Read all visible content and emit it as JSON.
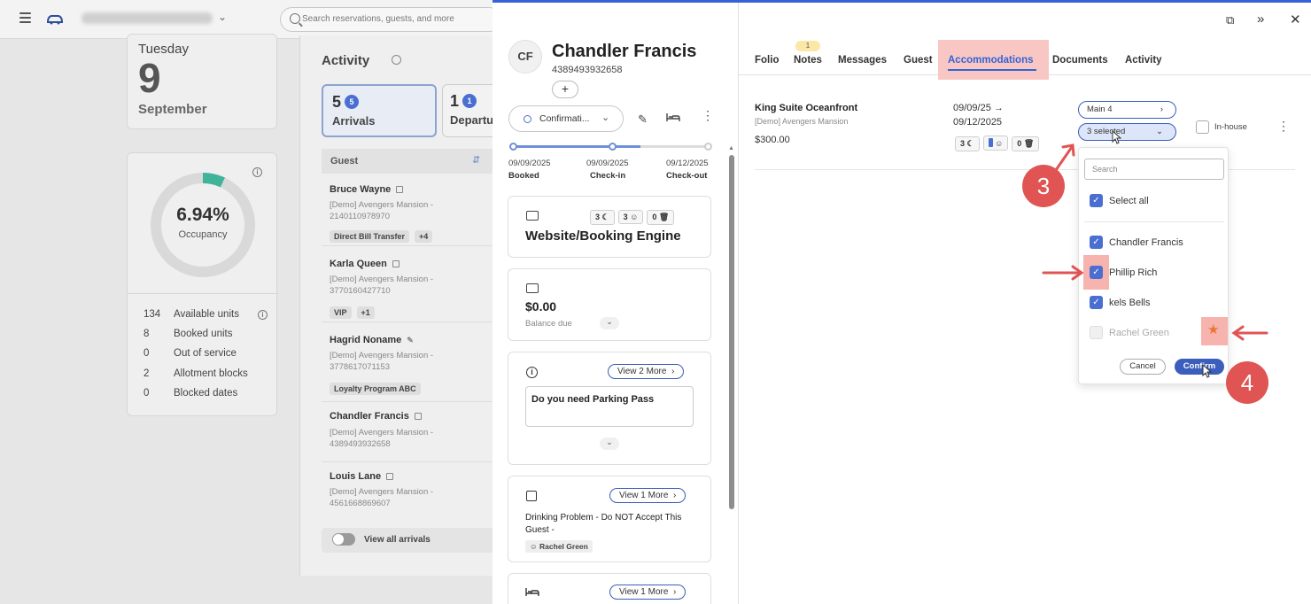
{
  "topbar": {
    "search_placeholder": "Search reservations, guests, and more"
  },
  "date_card": {
    "weekday": "Tuesday",
    "day": "9",
    "month": "September"
  },
  "occupancy": {
    "value": "6.94%",
    "label": "Occupancy",
    "percent": 6.94,
    "stats": [
      {
        "n": "134",
        "label": "Available units"
      },
      {
        "n": "8",
        "label": "Booked units"
      },
      {
        "n": "0",
        "label": "Out of service"
      },
      {
        "n": "2",
        "label": "Allotment blocks"
      },
      {
        "n": "0",
        "label": "Blocked dates"
      }
    ]
  },
  "activity": {
    "title": "Activity",
    "arrivals": {
      "count": "5",
      "badge": "5",
      "label": "Arrivals"
    },
    "departures": {
      "count": "1",
      "badge": "1",
      "label": "Departu"
    },
    "guest_header": "Guest",
    "guests": [
      {
        "name": "Bruce Wayne",
        "property": "[Demo] Avengers Mansion -",
        "phone": "2140110978970",
        "tags": [
          "Direct Bill Transfer",
          "+4"
        ]
      },
      {
        "name": "Karla Queen",
        "property": "[Demo] Avengers Mansion -",
        "phone": "3770160427710",
        "tags": [
          "VIP",
          "+1"
        ]
      },
      {
        "name": "Hagrid Noname",
        "property": "[Demo] Avengers Mansion -",
        "phone": "3778617071153",
        "tags": [
          "Loyalty Program ABC"
        ]
      },
      {
        "name": "Chandler Francis",
        "property": "[Demo] Avengers Mansion -",
        "phone": "4389493932658",
        "tags": []
      },
      {
        "name": "Louis Lane",
        "property": "[Demo] Avengers Mansion -",
        "phone": "4561668869607",
        "tags": []
      }
    ],
    "view_all": "View all arrivals"
  },
  "reservation": {
    "initials": "CF",
    "name": "Chandler Francis",
    "phone": "4389493932658",
    "add_label": "+",
    "status": "Confirmati...",
    "timeline": [
      {
        "date": "09/09/2025",
        "label": "Booked"
      },
      {
        "date": "09/09/2025",
        "label": "Check-in"
      },
      {
        "date": "09/12/2025",
        "label": "Check-out"
      }
    ],
    "source_card": {
      "chips": [
        "3",
        "3",
        "0"
      ],
      "title": "Website/Booking Engine"
    },
    "balance_card": {
      "amount": "$0.00",
      "label": "Balance due"
    },
    "question_card": {
      "view_more": "View 2 More",
      "text": "Do you need Parking Pass"
    },
    "note_card": {
      "view_more": "View 1 More",
      "text": "Drinking Problem - Do NOT Accept This Guest -",
      "author": "Rachel Green"
    },
    "bed_card": {
      "view_more": "View 1 More"
    }
  },
  "tabs": [
    {
      "label": "Folio"
    },
    {
      "label": "Notes",
      "badge": "1"
    },
    {
      "label": "Messages"
    },
    {
      "label": "Guest"
    },
    {
      "label": "Accommodations"
    },
    {
      "label": "Documents"
    },
    {
      "label": "Activity"
    }
  ],
  "accommodation": {
    "room": "King Suite Oceanfront",
    "property": "[Demo] Avengers Mansion",
    "price": "$300.00",
    "date_from": "09/09/25 →",
    "date_to": "09/12/2025",
    "chips": [
      "3",
      "",
      "0"
    ],
    "unit": "Main 4",
    "guests_select": "3 selected",
    "inhouse_label": "In-house"
  },
  "guest_dropdown": {
    "search_placeholder": "Search",
    "select_all": "Select all",
    "items": [
      {
        "name": "Chandler Francis",
        "checked": true
      },
      {
        "name": "Phillip Rich",
        "checked": true
      },
      {
        "name": "kels Bells",
        "checked": true
      },
      {
        "name": "Rachel Green",
        "checked": false,
        "disabled": true
      }
    ],
    "cancel": "Cancel",
    "confirm": "Confirm"
  },
  "annotations": {
    "step3": "3",
    "step4": "4"
  },
  "colors": {
    "accent": "#3562d4",
    "annotation": "#e05454",
    "highlight": "#f7b3ad",
    "occupancy": "#3fb49a"
  }
}
